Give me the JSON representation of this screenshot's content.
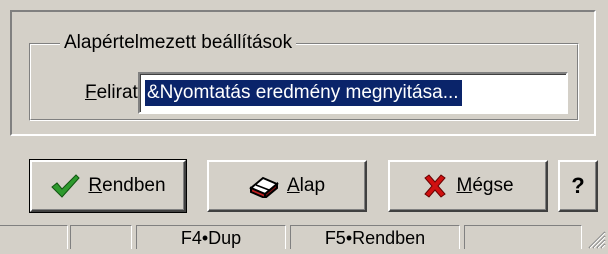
{
  "group": {
    "legend": "Alapértelmezett beállítások",
    "field_label_mnemonic": "F",
    "field_label_rest": "elirat",
    "field_value": "&Nyomtatás eredmény megnyitása..."
  },
  "buttons": {
    "ok": {
      "mnemonic": "R",
      "rest": "endben",
      "icon": "checkmark-icon"
    },
    "default": {
      "mnemonic": "A",
      "rest": "lap",
      "icon": "eraser-icon"
    },
    "cancel": {
      "mnemonic": "M",
      "rest": "égse",
      "icon": "red-x-icon"
    },
    "help": {
      "label": "?"
    }
  },
  "status_bar": {
    "cells": [
      "",
      "",
      "F4•Dup",
      "F5•Rendben",
      ""
    ]
  },
  "colors": {
    "face": "#d4d0c8",
    "selection": "#0a246a",
    "check_green": "#2e9a2e",
    "cancel_red": "#d01010"
  }
}
